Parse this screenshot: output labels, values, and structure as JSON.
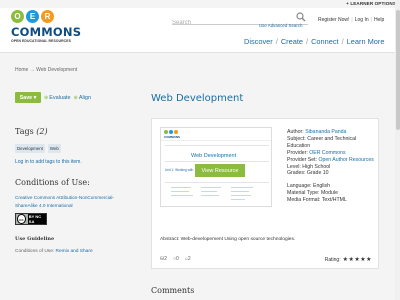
{
  "top": {
    "learner_options": "+ LEARNER OPTIONS"
  },
  "logo": {
    "letters": [
      "O",
      "E",
      "R"
    ],
    "colors": [
      "#8cbc3f",
      "#1a9cd8",
      "#f29b1d"
    ],
    "wordmark": "COMMONS",
    "tagline": "OPEN EDUCATIONAL RESOURCES"
  },
  "search": {
    "placeholder": "Search",
    "advanced": "Use Advanced Search"
  },
  "account": {
    "register": "Register Now!",
    "login": "Log In",
    "help": "Help"
  },
  "nav": {
    "items": [
      "Discover",
      "Create",
      "Connect",
      "Learn More"
    ]
  },
  "breadcrumb": {
    "home": "Home",
    "arrow": "→",
    "current": "Web Development"
  },
  "actions": {
    "save": "Save ▾",
    "evaluate": "Evaluate",
    "align": "Align"
  },
  "tags": {
    "title": "Tags",
    "count": "(2)",
    "items": [
      "Development",
      "Web"
    ],
    "login_prompt": "Log in to add tags to this item."
  },
  "conditions": {
    "title": "Conditions of Use:",
    "license": "Creative Commons Attribution-NonCommercial-ShareAlike 4.0 International",
    "badge_cc": "cc",
    "badge_text": "BY NC SA"
  },
  "guideline": {
    "title": "Use Guideline",
    "label": "Conditions of Use:",
    "value": "Remix and Share"
  },
  "resource": {
    "title": "Web Development",
    "thumb": {
      "title": "Web Development",
      "unit": "Unit 1: Working with",
      "button": "View Resource"
    },
    "meta": {
      "author_label": "Author:",
      "author": "Sibananda Panda",
      "subject_label": "Subject:",
      "subject": "Career and Technical Education",
      "provider_label": "Provider:",
      "provider": "OER Commons",
      "provider_set_label": "Provider Set:",
      "provider_set": "Open Author Resources",
      "level_label": "Level:",
      "level": "High School",
      "grades_label": "Grades:",
      "grades": "Grade 10",
      "language_label": "Language:",
      "language": "English",
      "material_label": "Material Type:",
      "material": "Module",
      "format_label": "Media Format:",
      "format": "Text/HTML"
    },
    "abstract_label": "Abstract:",
    "abstract": "Web-developement Using open source technologies.",
    "counts": {
      "saves": "2",
      "comments": "0",
      "tags": "2"
    },
    "rating_label": "Rating",
    "rating_stars": "★★★★★",
    "rating_value": 5
  },
  "comments": {
    "title": "Comments"
  }
}
